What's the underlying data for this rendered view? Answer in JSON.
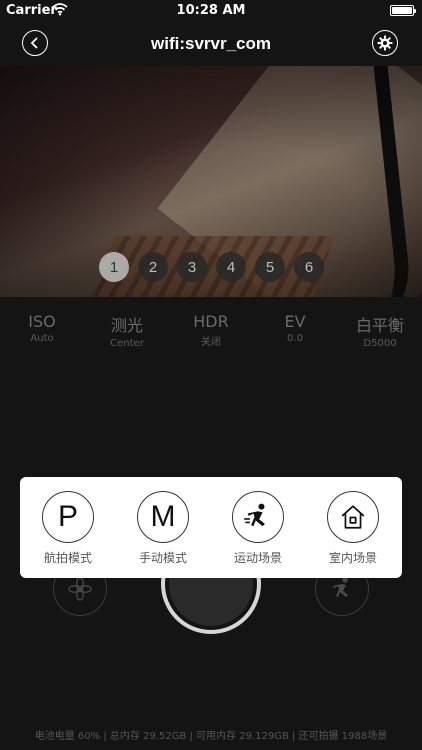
{
  "status_bar": {
    "carrier": "Carrier",
    "time": "10:28 AM"
  },
  "nav": {
    "title": "wifi:svrvr_com"
  },
  "preview": {
    "pages": [
      "1",
      "2",
      "3",
      "4",
      "5",
      "6"
    ],
    "active_page": "1"
  },
  "params": [
    {
      "name": "ISO",
      "value": "Auto"
    },
    {
      "name": "测光",
      "value": "Center"
    },
    {
      "name": "HDR",
      "value": "关闭"
    },
    {
      "name": "EV",
      "value": "0.0"
    },
    {
      "name": "白平衡",
      "value": "D5000"
    }
  ],
  "modes": [
    {
      "glyph": "P",
      "label": "航拍模式"
    },
    {
      "glyph": "M",
      "label": "手动模式"
    },
    {
      "icon": "running-person-icon",
      "label": "运动场景"
    },
    {
      "icon": "house-icon",
      "label": "室内场景"
    }
  ],
  "bottom_controls": {
    "left_icon": "flower-icon",
    "right_icon": "running-person-icon"
  },
  "storage_text": "电池电量 60% | 总内存 29.52GB | 可用内存 29.129GB | 还可拍摄 1988场景",
  "colors": {
    "background": "#141414",
    "popup": "#ffffff",
    "active_page": "#bebebe"
  }
}
